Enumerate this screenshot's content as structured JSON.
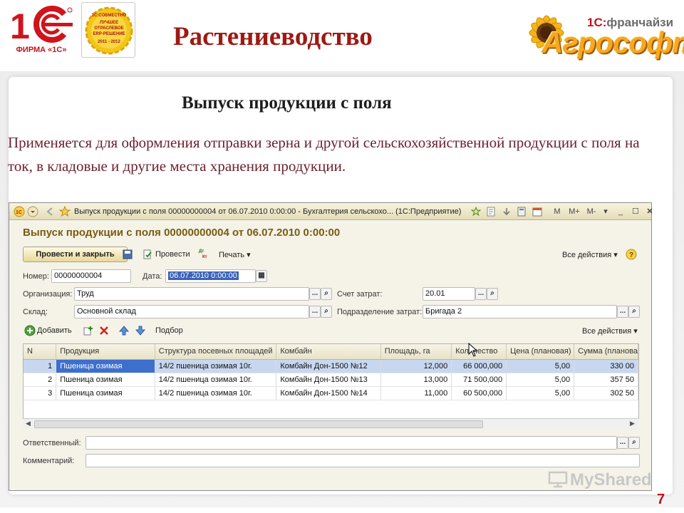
{
  "slide": {
    "logo_firm": "ФИРМА «1С»",
    "badge_lines": [
      "1С:СОВМЕСТНО",
      "ЛУЧШЕЕ",
      "ОТРАСЛЕВОЕ",
      "ERP-РЕШЕНИЕ",
      "2011 - 2012"
    ],
    "title": "Растениеводство",
    "franchise_prefix": "1С:",
    "franchise_word": "франчайзи",
    "brand": "Агрософт",
    "subtitle": "Выпуск продукции с поля",
    "description": "Применяется для оформления отправки зерна и другой сельскохозяйственной продукции с поля на ток, в кладовые и другие места хранения продукции.",
    "watermark": "MyShared",
    "page_number": "7"
  },
  "window": {
    "title": "Выпуск продукции с поля 00000000004 от 06.07.2010 0:00:00 - Бухгалтерия сельскохо... (1С:Предприятие)",
    "form_header": "Выпуск продукции с поля 00000000004 от 06.07.2010 0:00:00",
    "toolbar": {
      "post_close": "Провести и закрыть",
      "post": "Провести",
      "print": "Печать",
      "all_actions": "Все действия"
    },
    "fields": {
      "number_label": "Номер:",
      "number": "00000000004",
      "date_label": "Дата:",
      "date": "06.07.2010  0:00:00",
      "org_label": "Организация:",
      "org": "Труд",
      "cost_account_label": "Счет затрат:",
      "cost_account": "20.01",
      "warehouse_label": "Склад:",
      "warehouse": "Основной склад",
      "division_label": "Подразделение затрат:",
      "division": "Бригада 2",
      "responsible_label": "Ответственный:",
      "responsible": "",
      "comment_label": "Комментарий:",
      "comment": ""
    },
    "table_toolbar": {
      "add": "Добавить",
      "select": "Подбор",
      "all_actions": "Все действия"
    },
    "table": {
      "columns": [
        "N",
        "Продукция",
        "Структура посевных площадей",
        "Комбайн",
        "Площадь, га",
        "Количество",
        "Цена (плановая)",
        "Сумма (планова"
      ],
      "rows": [
        [
          "1",
          "Пшеница озимая",
          "14/2 пшеница озимая 10г.",
          "Комбайн Дон-1500 №12",
          "12,000",
          "66 000,000",
          "5,00",
          "330 00"
        ],
        [
          "2",
          "Пшеница озимая",
          "14/2 пшеница озимая 10г.",
          "Комбайн Дон-1500 №13",
          "13,000",
          "71 500,000",
          "5,00",
          "357 50"
        ],
        [
          "3",
          "Пшеница озимая",
          "14/2 пшеница озимая 10г.",
          "Комбайн Дон-1500 №14",
          "11,000",
          "60 500,000",
          "5,00",
          "302 50"
        ]
      ]
    }
  }
}
